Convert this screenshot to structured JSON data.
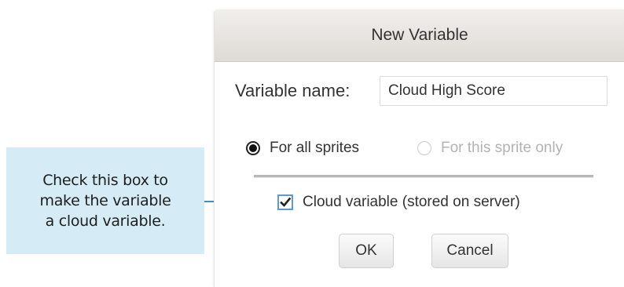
{
  "callout": {
    "text": "Check this box to\nmake the variable\na cloud variable."
  },
  "dialog": {
    "title": "New Variable",
    "variable_name_label": "Variable name:",
    "variable_name_value": "Cloud High Score",
    "radio_all_label": "For all sprites",
    "radio_all_selected": true,
    "radio_this_label": "For this sprite only",
    "radio_this_selected": false,
    "cloud_checkbox_label": "Cloud variable (stored on server)",
    "cloud_checkbox_checked": true,
    "ok_label": "OK",
    "cancel_label": "Cancel"
  },
  "colors": {
    "callout_background": "#d5ecf6",
    "arrow": "#3d8fc8",
    "checkbox_border": "#5a9bd5"
  }
}
